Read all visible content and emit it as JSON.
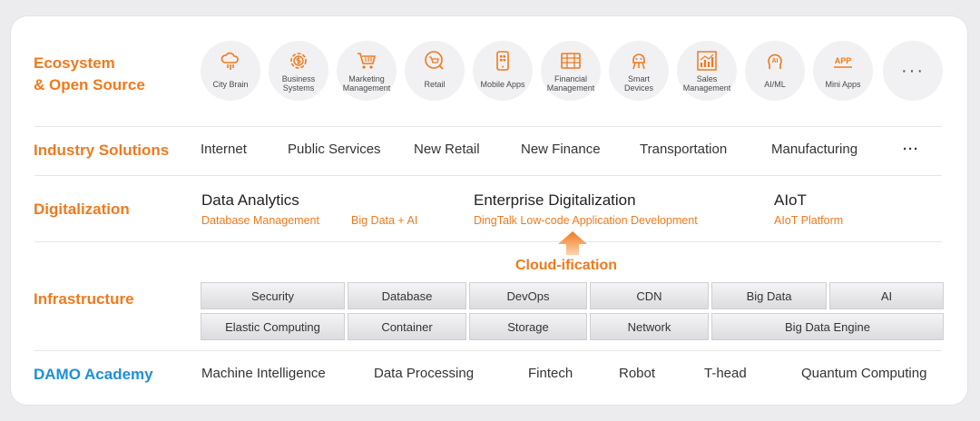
{
  "rows": {
    "ecosystem": "Ecosystem\n& Open Source",
    "industry": "Industry Solutions",
    "digitalization": "Digitalization",
    "infrastructure": "Infrastructure",
    "damo": "DAMO Academy"
  },
  "ecosystem_items": [
    {
      "label": "City Brain",
      "icon": "cloud-icon"
    },
    {
      "label": "Business\nSystems",
      "icon": "gear-dollar-icon"
    },
    {
      "label": "Marketing\nManagement",
      "icon": "shopping-cart-icon"
    },
    {
      "label": "Retail",
      "icon": "cart-circle-icon"
    },
    {
      "label": "Mobile Apps",
      "icon": "mobile-phone-icon"
    },
    {
      "label": "Financial\nManagement",
      "icon": "bank-icon"
    },
    {
      "label": "Smart\nDevices",
      "icon": "robot-icon"
    },
    {
      "label": "Sales\nManagement",
      "icon": "bar-chart-icon"
    },
    {
      "label": "AI/ML",
      "icon": "ai-head-icon"
    },
    {
      "label": "Mini Apps",
      "icon": "app-icon"
    }
  ],
  "ecosystem_more": "···",
  "app_icon_text": "APP",
  "ai_icon_text": "AI",
  "industry_items": [
    "Internet",
    "Public Services",
    "New Retail",
    "New Finance",
    "Transportation",
    "Manufacturing"
  ],
  "industry_more": "···",
  "digitalization": {
    "data_analytics": {
      "title": "Data Analytics",
      "subs": [
        "Database Management",
        "Big Data + AI"
      ]
    },
    "enterprise": {
      "title": "Enterprise Digitalization",
      "subs": [
        "DingTalk Low-code Application Development"
      ]
    },
    "aiot": {
      "title": "AIoT",
      "subs": [
        "AIoT Platform"
      ]
    }
  },
  "cloudification": "Cloud-ification",
  "infrastructure": {
    "row1": [
      "Security",
      "Database",
      "DevOps",
      "CDN",
      "Big Data",
      "AI"
    ],
    "row2": [
      "Elastic Computing",
      "Container",
      "Storage",
      "Network",
      "Big Data Engine"
    ]
  },
  "damo_items": [
    "Machine Intelligence",
    "Data Processing",
    "Fintech",
    "Robot",
    "T-head",
    "Quantum Computing"
  ],
  "colors": {
    "accent": "#ef7a1e",
    "damo_blue": "#1f8fd8"
  }
}
